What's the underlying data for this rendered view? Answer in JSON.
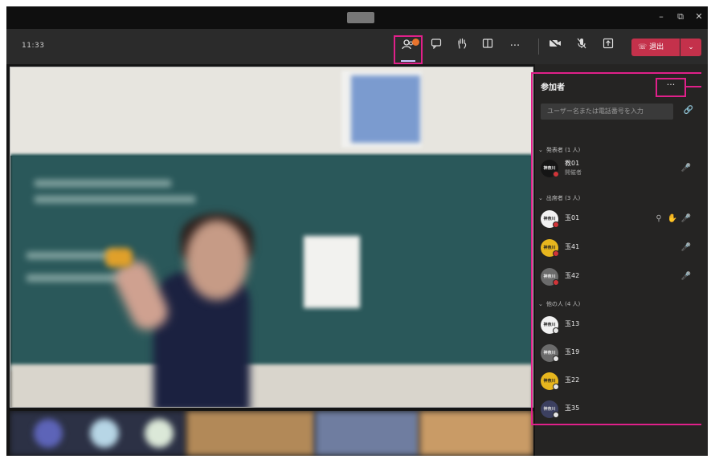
{
  "toolbar": {
    "timer": "11:33",
    "leave_label": "退出",
    "more_label": "···",
    "caret": "⌄"
  },
  "window_controls": {
    "minimize": "–",
    "restore": "⧉",
    "close": "✕"
  },
  "panel": {
    "title": "参加者",
    "more_label": "···",
    "search_placeholder": "ユーザー名または電話番号を入力",
    "sections": {
      "organizers": "発表者 (1 人)",
      "attendees": "出席者 (3 人)",
      "others": "他の人 (4 人)"
    },
    "organizer": {
      "name": "教01",
      "role": "開催者",
      "avatar": "神奈川"
    },
    "attendees": [
      {
        "name": "玉01",
        "avatar": "神奈川"
      },
      {
        "name": "玉41",
        "avatar": "神奈川"
      },
      {
        "name": "玉42",
        "avatar": "神奈川"
      }
    ],
    "others": [
      {
        "name": "玉13",
        "avatar": "神奈川"
      },
      {
        "name": "玉19",
        "avatar": "神奈川"
      },
      {
        "name": "玉22",
        "avatar": "神奈川"
      },
      {
        "name": "玉35",
        "avatar": "神奈川"
      }
    ]
  },
  "colors": {
    "highlight": "#e0208a",
    "leave": "#c4314b",
    "badge": "#e8742e"
  }
}
